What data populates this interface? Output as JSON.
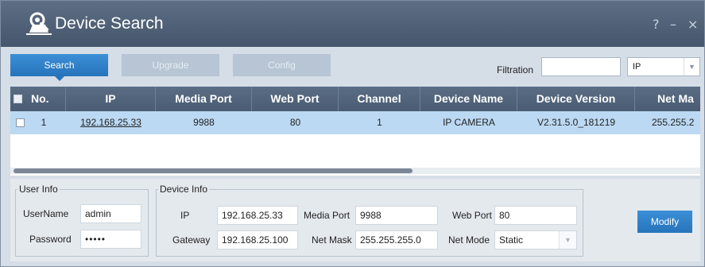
{
  "window": {
    "title": "Device Search",
    "help_glyph": "?",
    "minimize_glyph": "–",
    "close_glyph": "×"
  },
  "toolbar": {
    "tabs": [
      {
        "label": "Search",
        "state": "active"
      },
      {
        "label": "Upgrade",
        "state": "disabled"
      },
      {
        "label": "Config",
        "state": "disabled"
      }
    ],
    "filtration_label": "Filtration",
    "filtration_value": "",
    "filter_type": "IP"
  },
  "table": {
    "headers": [
      "No.",
      "IP",
      "Media Port",
      "Web Port",
      "Channel",
      "Device Name",
      "Device Version",
      "Net Ma"
    ],
    "rows": [
      {
        "no": "1",
        "ip": "192.168.25.33",
        "media_port": "9988",
        "web_port": "80",
        "channel": "1",
        "device_name": "IP CAMERA",
        "device_version": "V2.31.5.0_181219",
        "net_mask": "255.255.2"
      }
    ]
  },
  "user_info": {
    "legend": "User Info",
    "username_label": "UserName",
    "username_value": "admin",
    "password_label": "Password",
    "password_value": "•••••"
  },
  "device_info": {
    "legend": "Device Info",
    "ip_label": "IP",
    "ip_value": "192.168.25.33",
    "media_port_label": "Media Port",
    "media_port_value": "9988",
    "web_port_label": "Web Port",
    "web_port_value": "80",
    "gateway_label": "Gateway",
    "gateway_value": "192.168.25.100",
    "net_mask_label": "Net Mask",
    "net_mask_value": "255.255.255.0",
    "net_mode_label": "Net Mode",
    "net_mode_value": "Static"
  },
  "modify_label": "Modify",
  "colors": {
    "titlebar": "#4e5f75",
    "accent_blue": "#2f82c9",
    "selected_row": "#bcd9f3",
    "panel_bg": "#d5dde6"
  },
  "icons": {
    "logo": "magnifier-device-icon",
    "dropdown": "chevron-down-icon"
  }
}
